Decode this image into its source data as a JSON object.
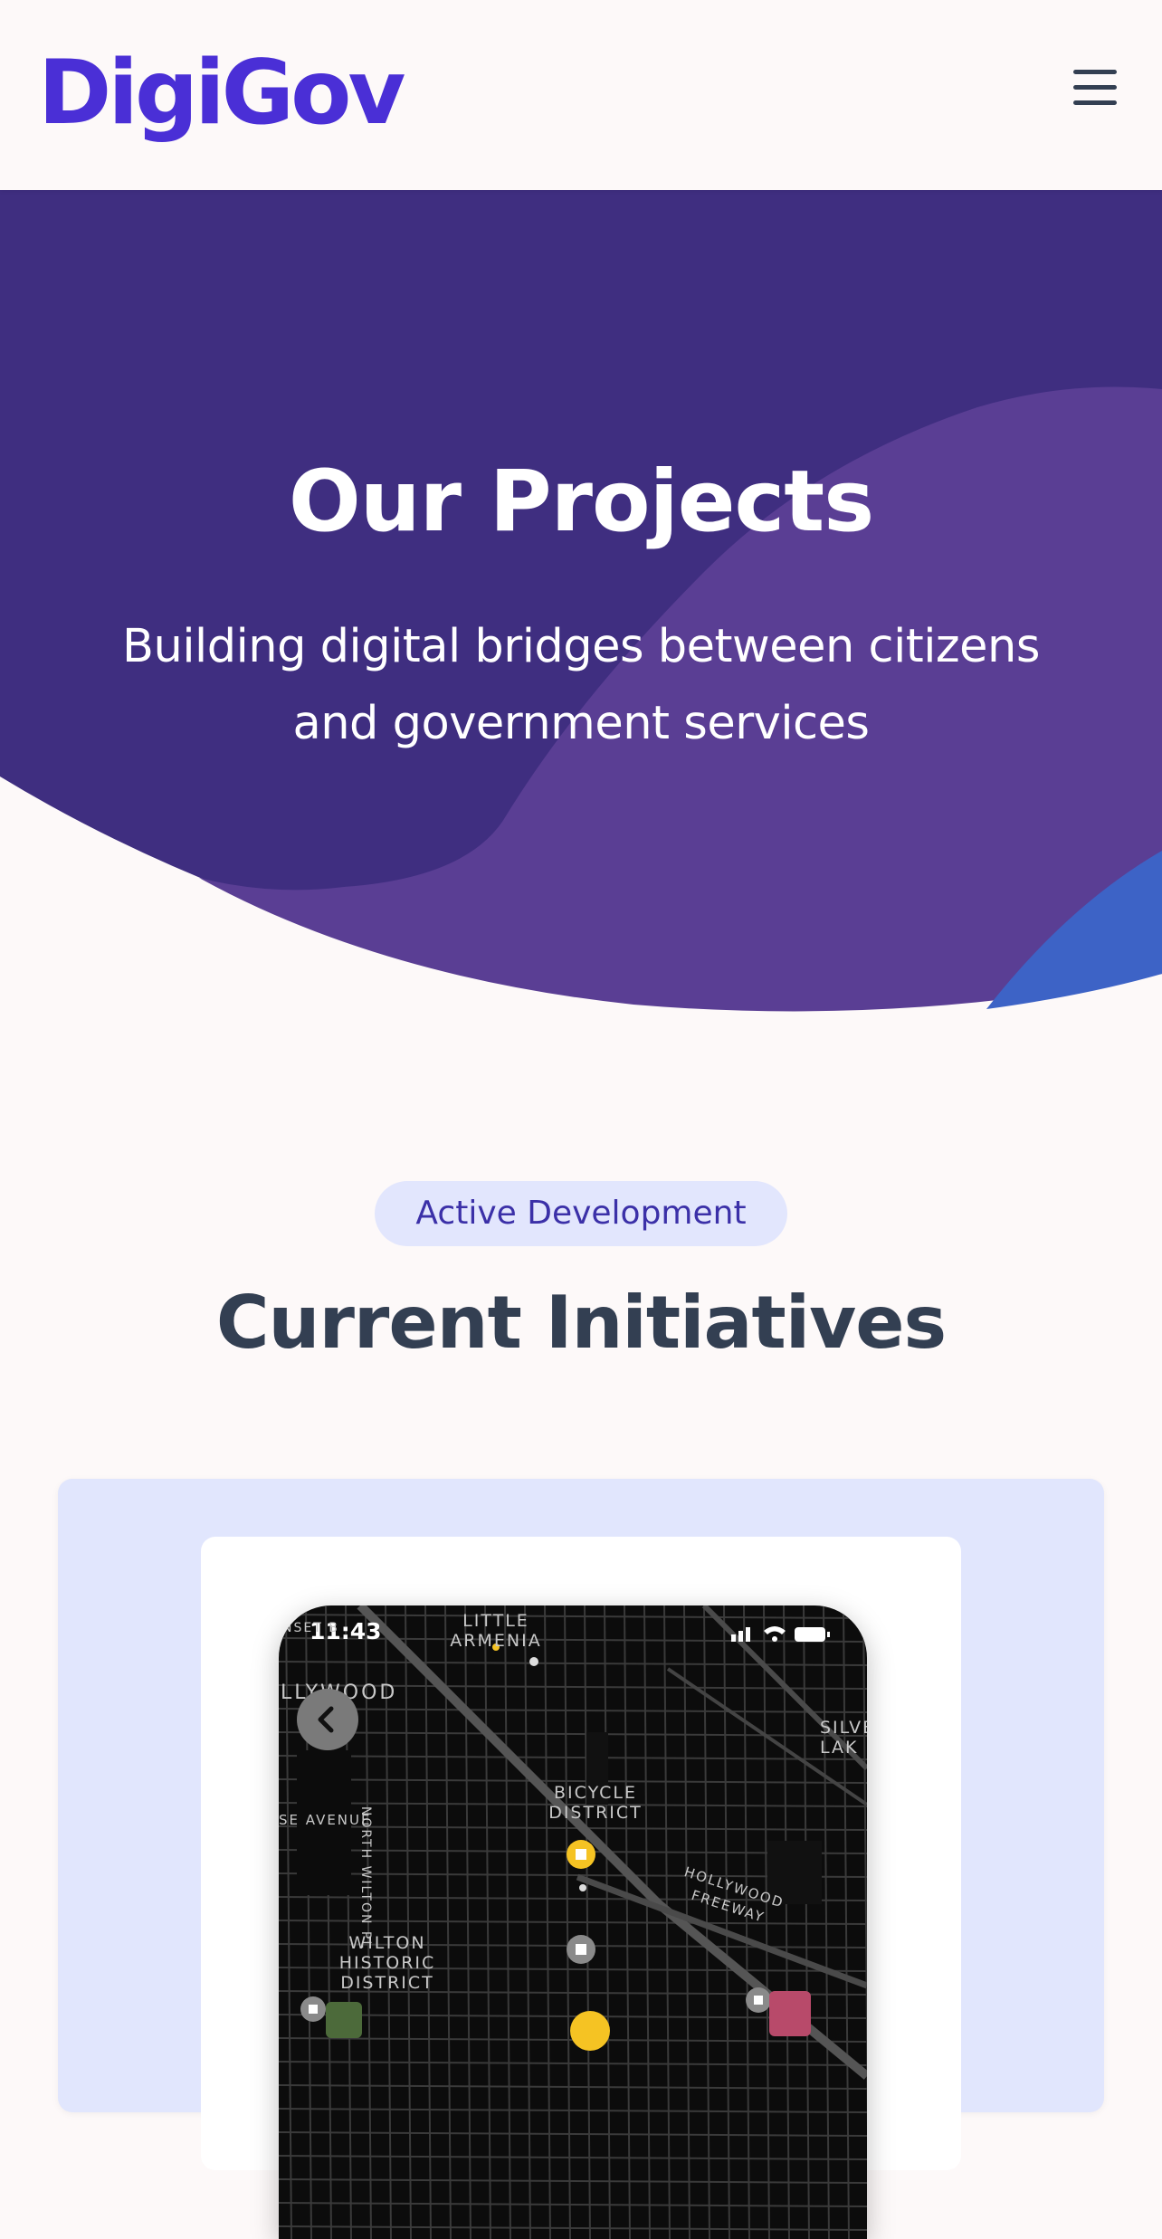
{
  "header": {
    "logo_text": "DigiGov",
    "menu_icon": "hamburger-menu-icon"
  },
  "hero": {
    "title": "Our Projects",
    "subtitle": "Building digital bridges between citizens and government services"
  },
  "section": {
    "badge": "Active Development",
    "title": "Current Initiatives"
  },
  "project_card": {
    "phone": {
      "status_time": "11:43",
      "map_labels": {
        "little_armenia": "LITTLE\nARMENIA",
        "hollywood": "LLYWOOD",
        "sunset": "NSET B",
        "silver_lake": "SILVE\nLAK",
        "avenue": "SE AVENUE",
        "north_wilton": "NORTH WILTON PL",
        "bicycle_district": "BICYCLE\nDISTRICT",
        "hollywood_freeway": "HOLLYWOOD FREEWAY",
        "wilton_historic": "WILTON\nHISTORIC\nDISTRICT"
      }
    }
  },
  "colors": {
    "brand": "#4a2fd6",
    "hero_dark": "#3f2e80",
    "hero_light": "#5a3e94",
    "hero_blue": "#3d63c6",
    "badge_bg": "#e2e6fd",
    "badge_text": "#3b30a8",
    "heading": "#333f52",
    "card_bg": "#e1e6fd",
    "marker_yellow": "#f5c323"
  }
}
